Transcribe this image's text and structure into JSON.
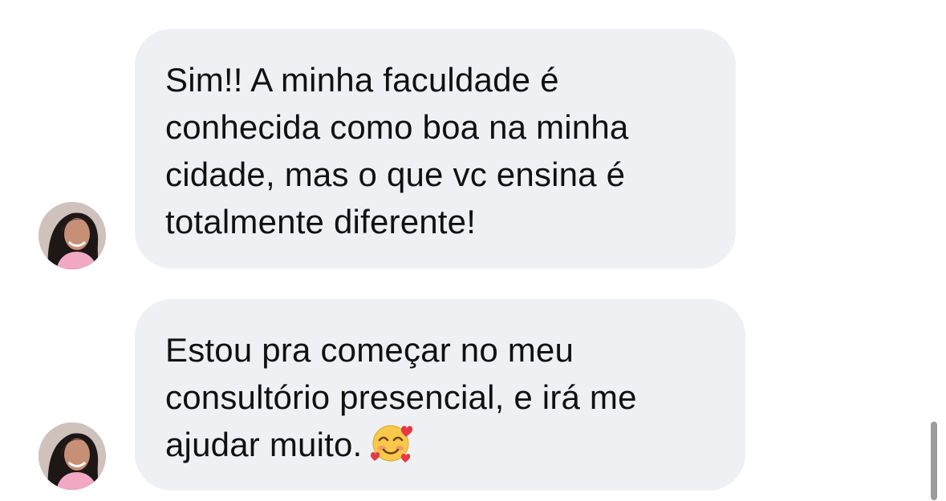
{
  "conversation": {
    "messages": [
      {
        "sender": "avatar",
        "text": "Sim!! A minha faculdade é\nconhecida como boa na minha\ncidade, mas o que vc ensina é\ntotalmente diferente!"
      },
      {
        "sender": "avatar",
        "text": "Estou pra começar no meu\nconsultório presencial, e irá me\najudar muito.",
        "emoji": "smiling-face-with-hearts-icon"
      }
    ]
  },
  "colors": {
    "bubble": "#eff0f4",
    "text": "#111111",
    "scrollbar": "#9c9c9c"
  }
}
